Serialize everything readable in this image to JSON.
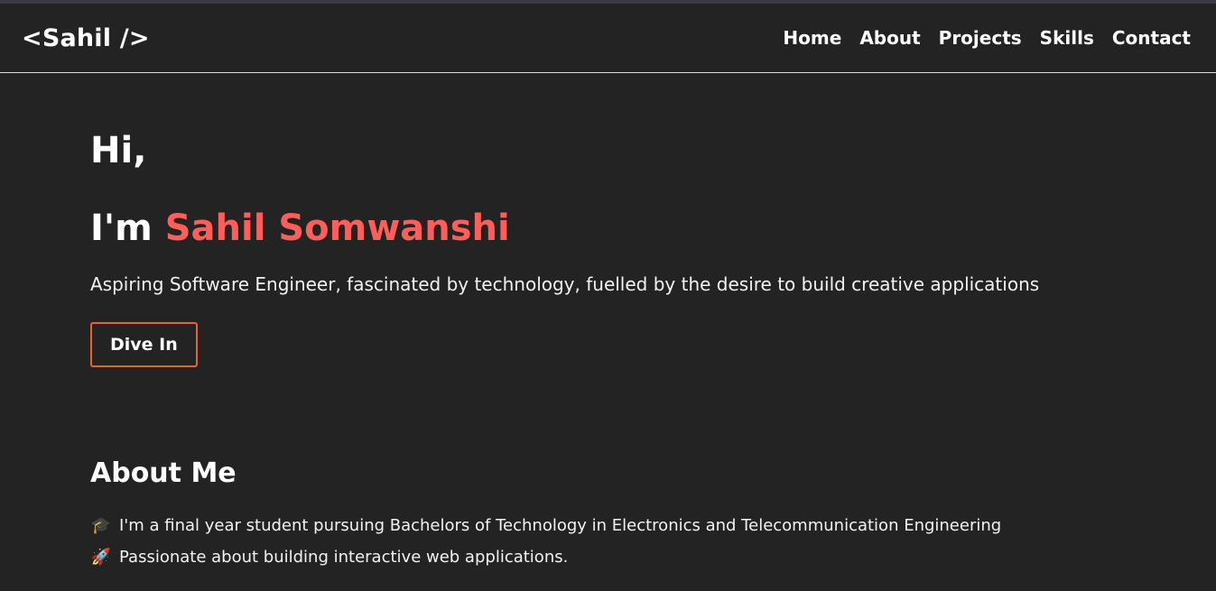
{
  "nav": {
    "logo": "<Sahil />",
    "links": [
      "Home",
      "About",
      "Projects",
      "Skills",
      "Contact"
    ]
  },
  "hero": {
    "greeting": "Hi,",
    "intro_prefix": "I'm ",
    "name": "Sahil Somwanshi",
    "tagline": "Aspiring Software Engineer, fascinated by technology, fuelled by the desire to build creative applications",
    "cta_label": "Dive In"
  },
  "about": {
    "heading": "About Me",
    "items": [
      {
        "icon": "graduation-cap-icon",
        "emoji": "🎓",
        "text": "I'm a final year student pursuing Bachelors of Technology in Electronics and Telecommunication Engineering"
      },
      {
        "icon": "rocket-icon",
        "emoji": "🚀",
        "text": "Passionate about building interactive web applications."
      }
    ]
  },
  "colors": {
    "background": "#232323",
    "accent_name": "#ff5e5b",
    "button_border": "#e8632b"
  }
}
